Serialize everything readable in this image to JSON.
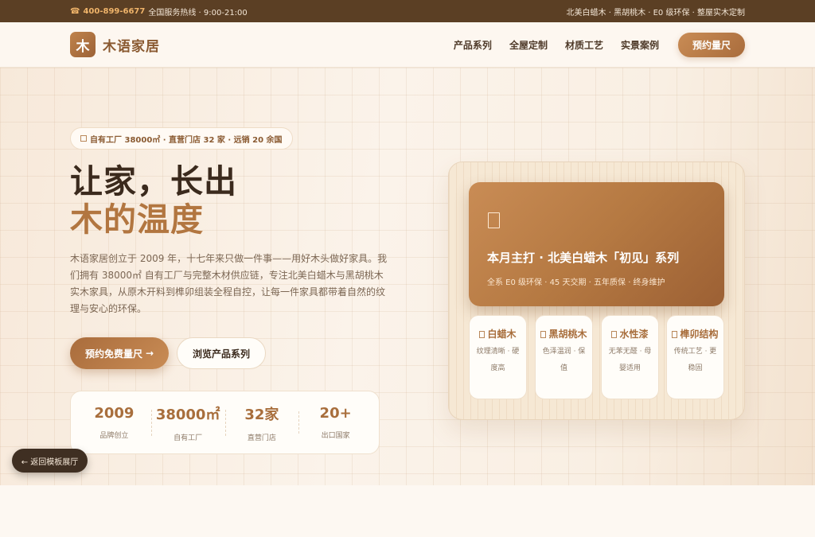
{
  "topbar": {
    "phone_icon": "☎",
    "phone": "400-899-6677",
    "hotline_text": "全国服务热线 · 9:00-21:00",
    "right_text": "北美白蜡木 · 黑胡桃木 · E0 级环保 · 整屋实木定制"
  },
  "header": {
    "logo_char": "木",
    "brand_name": "木语家居",
    "nav": [
      "产品系列",
      "全屋定制",
      "材质工艺",
      "实景案例"
    ],
    "cta": "预约量尺"
  },
  "hero": {
    "badge": "自有工厂 38000㎡ · 直营门店 32 家 · 远销 20 余国",
    "title_line1": "让家，长出",
    "title_line2": "木的温度",
    "description": "木语家居创立于 2009 年，十七年来只做一件事——用好木头做好家具。我们拥有 38000㎡ 自有工厂与完整木材供应链，专注北美白蜡木与黑胡桃木实木家具，从原木开料到榫卯组装全程自控，让每一件家具都带着自然的纹理与安心的环保。",
    "primary_button": "预约免费量尺",
    "primary_button_arrow": "→",
    "secondary_button": "浏览产品系列",
    "stats": [
      {
        "value": "2009",
        "label": "品牌创立"
      },
      {
        "value": "38000㎡",
        "label": "自有工厂"
      },
      {
        "value": "32家",
        "label": "直营门店"
      },
      {
        "value": "20+",
        "label": "出口国家"
      }
    ]
  },
  "showcase": {
    "feature_title": "本月主打 · 北美白蜡木「初见」系列",
    "feature_sub": "全系 E0 级环保 · 45 天交期 · 五年质保 · 终身维护",
    "cards": [
      {
        "title": "白蜡木",
        "desc": "纹理清晰 · 硬度高"
      },
      {
        "title": "黑胡桃木",
        "desc": "色泽温润 · 保值"
      },
      {
        "title": "水性漆",
        "desc": "无苯无醛 · 母婴适用"
      },
      {
        "title": "榫卯结构",
        "desc": "传统工艺 · 更稳固"
      }
    ]
  },
  "back_button": "← 返回模板展厅",
  "colors": {
    "brand": "#b27640",
    "dark": "#5b3f24",
    "accent_phone": "#f0b46a"
  }
}
